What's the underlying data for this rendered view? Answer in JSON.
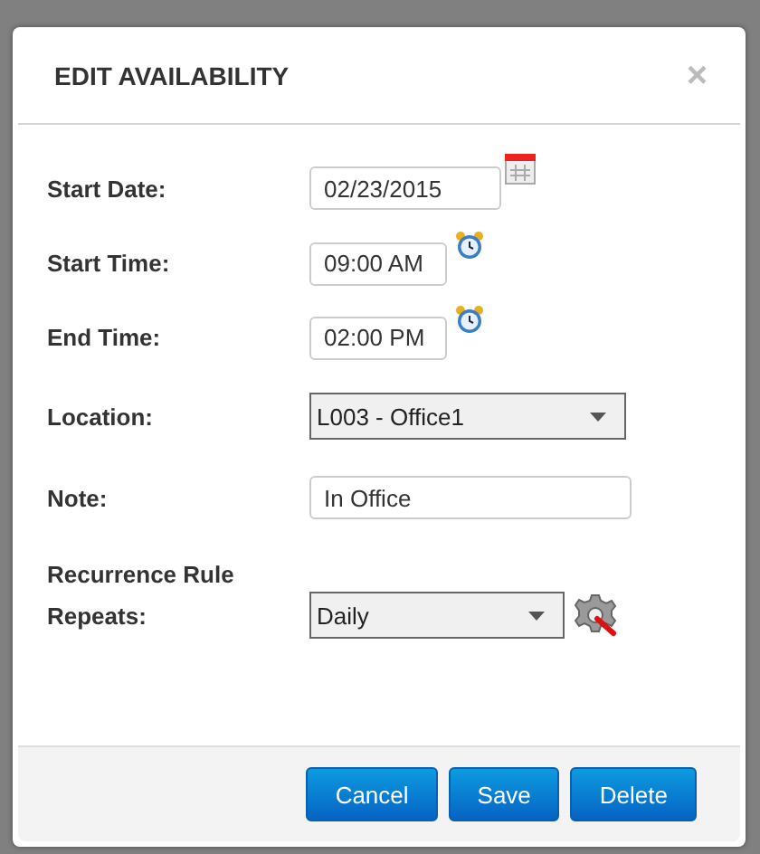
{
  "dialog": {
    "title": "EDIT AVAILABILITY",
    "close": "×"
  },
  "fields": [
    {
      "kind": "date",
      "label": "Start Date:",
      "value": "02/23/2015"
    },
    {
      "kind": "time",
      "label": "Start Time:",
      "value": "09:00 AM"
    },
    {
      "kind": "time",
      "label": "End Time:",
      "value": "02:00 PM"
    },
    {
      "kind": "select",
      "label": "Location:",
      "value": "L003 - Office1"
    },
    {
      "kind": "text",
      "label": "Note:",
      "value": "In Office"
    },
    {
      "kind": "heading",
      "label": "Recurrence Rule"
    },
    {
      "kind": "recurrence",
      "label": "Repeats:",
      "value": "Daily"
    }
  ],
  "buttons": [
    "Cancel",
    "Save",
    "Delete"
  ]
}
